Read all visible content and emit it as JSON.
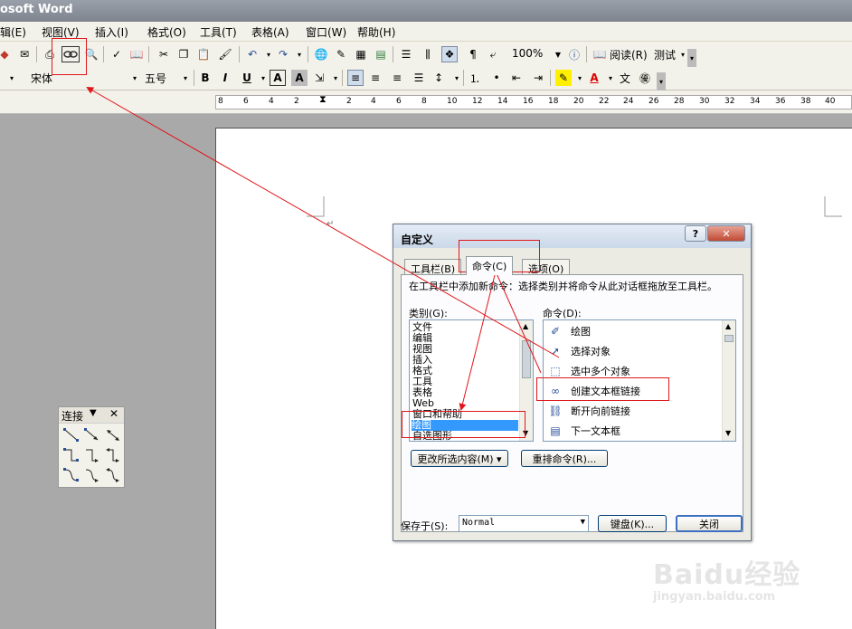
{
  "window": {
    "title": "osoft Word"
  },
  "menubar": {
    "items": [
      "辑(E)",
      "视图(V)",
      "插入(I)",
      "格式(O)",
      "工具(T)",
      "表格(A)",
      "窗口(W)",
      "帮助(H)"
    ]
  },
  "toolbar": {
    "zoom": "100%",
    "read_label": "阅读(R)",
    "test_label": "测试",
    "font_name": "宋体",
    "font_size": "五号",
    "bold": "B",
    "italic": "I",
    "underline": "U",
    "char_border": "A",
    "char_shade": "A"
  },
  "ruler": {
    "ticks": [
      "8",
      "6",
      "4",
      "2",
      "2",
      "4",
      "6",
      "8",
      "10",
      "12",
      "14",
      "16",
      "18",
      "20",
      "22",
      "24",
      "26",
      "28",
      "30",
      "32",
      "34",
      "36",
      "38",
      "40"
    ]
  },
  "palette": {
    "title": "连接"
  },
  "dialog": {
    "title": "自定义",
    "help": "?",
    "close_x": "✕",
    "tabs": [
      "工具栏(B)",
      "命令(C)",
      "选项(O)"
    ],
    "instruction": "在工具栏中添加新命令：选择类别并将命令从此对话框拖放至工具栏。",
    "categories_label": "类别(G):",
    "categories": [
      "文件",
      "编辑",
      "视图",
      "插入",
      "格式",
      "工具",
      "表格",
      "Web",
      "窗口和帮助",
      "绘图",
      "自选图形"
    ],
    "selected_category": "绘图",
    "commands_label": "命令(D):",
    "commands": [
      "绘图",
      "选择对象",
      "选中多个对象",
      "创建文本框链接",
      "断开向前链接",
      "下一文本框"
    ],
    "modify_button": "更改所选内容(M) ▾",
    "rearrange_button": "重排命令(R)...",
    "save_in_label": "保存于(S):",
    "save_in_value": "Normal",
    "keyboard_button": "键盘(K)...",
    "close_button": "关闭"
  },
  "watermark": {
    "brand": "Baidu经验",
    "url": "jingyan.baidu.com"
  },
  "colors": {
    "annotation": "#e0161b",
    "selection": "#3399ff",
    "accent": "#2a4f9a"
  }
}
